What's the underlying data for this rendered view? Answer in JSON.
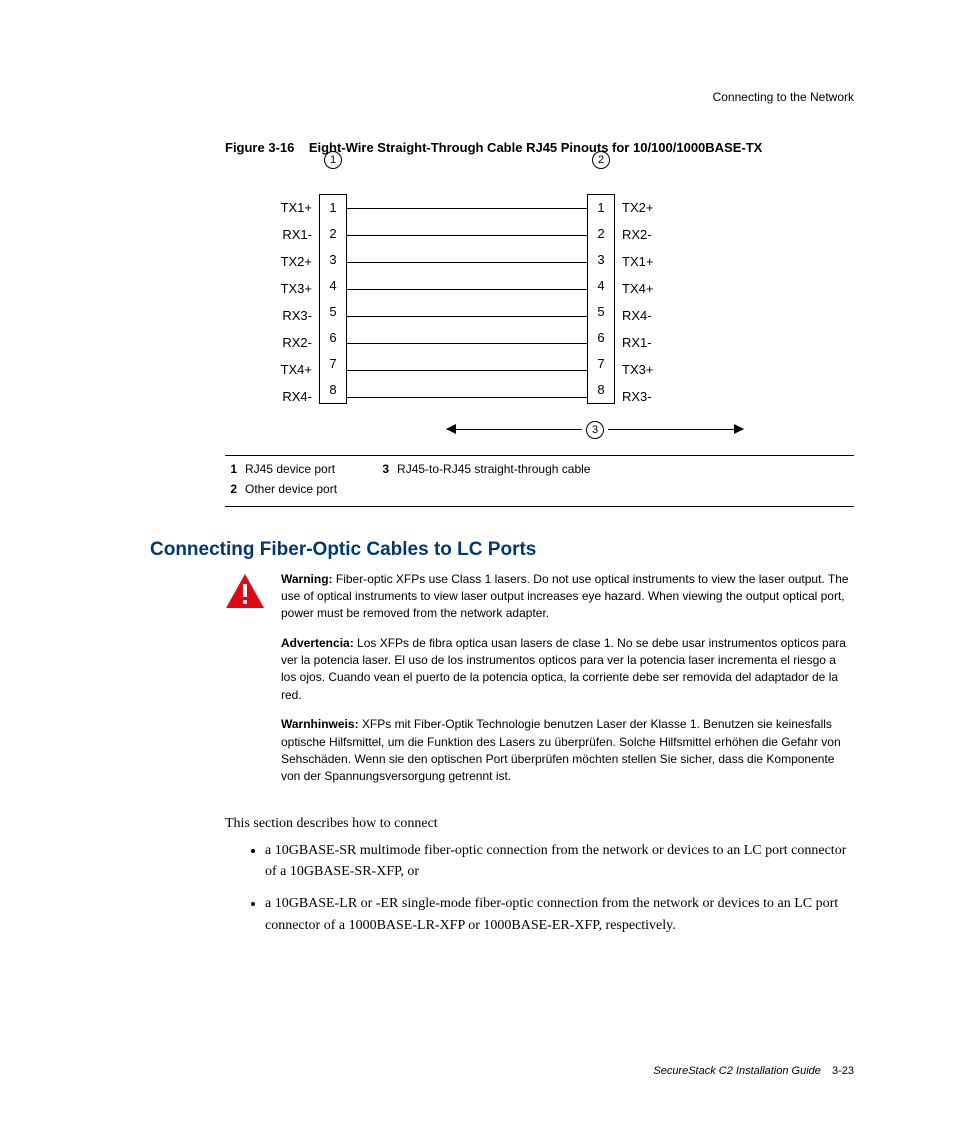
{
  "header": {
    "running": "Connecting to the Network"
  },
  "figure": {
    "label": "Figure 3-16",
    "title": "Eight-Wire Straight-Through Cable RJ45 Pinouts for 10/100/1000BASE-TX",
    "left_signals": [
      "TX1+",
      "RX1-",
      "TX2+",
      "TX3+",
      "RX3-",
      "RX2-",
      "TX4+",
      "RX4-"
    ],
    "pins": [
      "1",
      "2",
      "3",
      "4",
      "5",
      "6",
      "7",
      "8"
    ],
    "right_signals": [
      "TX2+",
      "RX2-",
      "TX1+",
      "TX4+",
      "RX4-",
      "RX1-",
      "TX3+",
      "RX3-"
    ],
    "callout_left": "1",
    "callout_right": "2",
    "callout_arrow": "3"
  },
  "legend": {
    "i1n": "1",
    "i1t": "RJ45 device port",
    "i2n": "2",
    "i2t": "Other device port",
    "i3n": "3",
    "i3t": "RJ45-to-RJ45 straight-through cable"
  },
  "section": {
    "heading": "Connecting Fiber-Optic Cables to LC Ports"
  },
  "warning": {
    "en_label": "Warning:",
    "en": " Fiber-optic XFPs use Class 1 lasers. Do not use optical instruments to view the laser output. The use of optical instruments to view laser output increases eye hazard. When viewing the output optical port, power must be removed from the network adapter.",
    "es_label": "Advertencia:",
    "es": " Los XFPs de fibra optica usan lasers de clase 1. No se debe usar instrumentos opticos para ver la potencia laser. El uso de los instrumentos opticos para ver la potencia laser incrementa el riesgo a los ojos. Cuando vean el puerto de la potencia optica, la corriente debe ser removida del adaptador de la red.",
    "de_label": "Warnhinweis:",
    "de": " XFPs mit Fiber-Optik Technologie benutzen Laser der Klasse 1. Benutzen sie keinesfalls optische Hilfsmittel, um die Funktion des Lasers zu überprüfen. Solche Hilfsmittel erhöhen die Gefahr von Sehschäden. Wenn sie den optischen Port überprüfen möchten stellen Sie sicher, dass die Komponente von der Spannungsversorgung getrennt ist."
  },
  "body": {
    "intro": "This section describes how to connect",
    "b1": "a 10GBASE-SR multimode fiber-optic connection from the network or devices to an LC port connector of a 10GBASE-SR-XFP, or",
    "b2": "a 10GBASE-LR or -ER single-mode fiber-optic connection from the network or devices to an LC port connector of a 1000BASE-LR-XFP or 1000BASE-ER-XFP, respectively."
  },
  "footer": {
    "book": "SecureStack C2 Installation Guide",
    "page": "3-23"
  }
}
